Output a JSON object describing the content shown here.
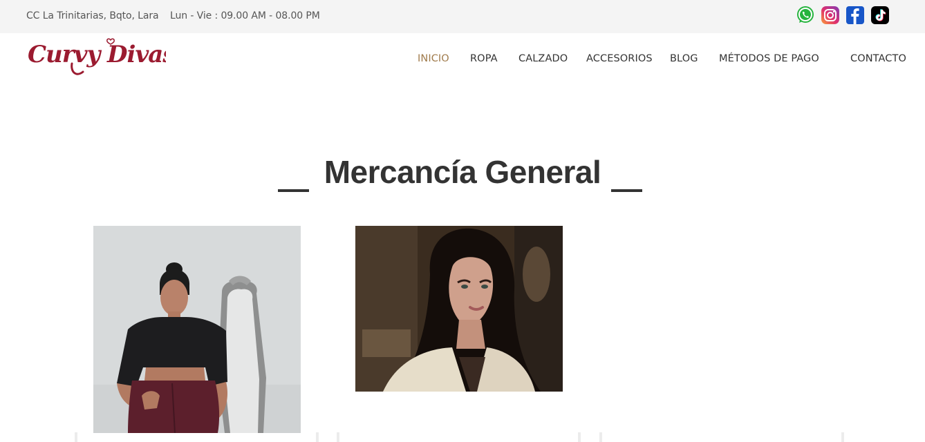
{
  "topbar": {
    "address": "CC La Trinitarias, Bqto, Lara",
    "hours": "Lun - Vie : 09.00 AM - 08.00 PM",
    "social": [
      "whatsapp-icon",
      "instagram-icon",
      "facebook-icon",
      "tiktok-icon"
    ]
  },
  "brand": {
    "logo_text": "Curvy Divas",
    "color": "#9b1b30"
  },
  "nav": {
    "items": [
      "INICIO",
      "ROPA",
      "CALZADO",
      "ACCESORIOS",
      "BLOG",
      "MÉTODOS DE PAGO",
      "CONTACTO"
    ],
    "active": "INICIO",
    "active_color": "#a07b4c"
  },
  "section": {
    "title": "Mercancía General"
  },
  "products": [
    {
      "image": "woman-in-black-crop-top-with-mirror"
    },
    {
      "image": "woman-with-dark-long-hair-portrait"
    }
  ]
}
